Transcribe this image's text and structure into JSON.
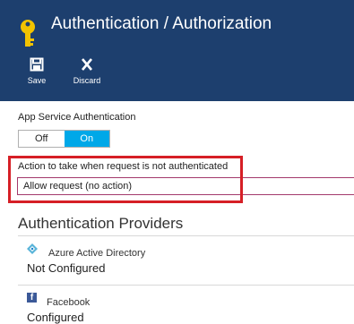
{
  "header": {
    "title": "Authentication / Authorization",
    "save_label": "Save",
    "discard_label": "Discard"
  },
  "app_service_auth": {
    "label": "App Service Authentication",
    "options": [
      "Off",
      "On"
    ],
    "selected": "On"
  },
  "action": {
    "label": "Action to take when request is not authenticated",
    "value": "Allow request (no action)"
  },
  "providers": {
    "section_title": "Authentication Providers",
    "items": [
      {
        "name": "Azure Active Directory",
        "status": "Not Configured",
        "icon": "azure-ad-icon"
      },
      {
        "name": "Facebook",
        "status": "Configured",
        "icon": "facebook-icon"
      }
    ]
  },
  "colors": {
    "header_bg": "#1d3f6e",
    "toggle_on": "#00a8e8",
    "highlight_box": "#d61f26",
    "key_icon": "#f2c300"
  }
}
